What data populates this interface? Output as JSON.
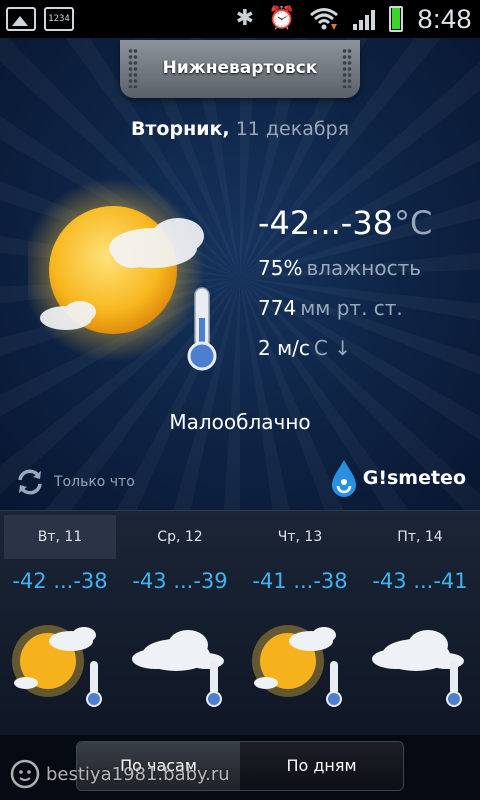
{
  "status_bar": {
    "time": "8:48",
    "icons": [
      "gallery-icon",
      "clock-widget-icon",
      "bluetooth-icon",
      "alarm-icon",
      "wifi-icon",
      "signal-icon",
      "battery-icon"
    ],
    "battery_level": 0.95
  },
  "city": "Нижневартовск",
  "date": {
    "weekday": "Вторник,",
    "day_month": "11 декабря"
  },
  "current": {
    "temp_range": "-42...-38",
    "temp_unit": "°C",
    "humidity_value": "75%",
    "humidity_label": "влажность",
    "pressure_value": "774",
    "pressure_unit": "мм рт. ст.",
    "wind_value": "2 м/с",
    "wind_dir_glyph": "С ↓",
    "condition": "Малооблачно",
    "icon": "sun-cloud-thermometer-icon"
  },
  "refresh": {
    "label": "Только что"
  },
  "brand": {
    "name": "G!smeteo"
  },
  "forecast": [
    {
      "label": "Вт, 11",
      "temp": "-42 ...-38",
      "icon": "sun-cloud-icon",
      "active": true
    },
    {
      "label": "Ср, 12",
      "temp": "-43 ...-39",
      "icon": "cloud-icon",
      "active": false
    },
    {
      "label": "Чт, 13",
      "temp": "-41 ...-38",
      "icon": "sun-cloud-icon",
      "active": false
    },
    {
      "label": "Пт, 14",
      "temp": "-43 ...-41",
      "icon": "cloud-icon",
      "active": false
    }
  ],
  "bottom_tabs": {
    "hours": "По часам",
    "days": "По дням",
    "selected": "hours"
  },
  "watermark": "bestiya1981.baby.ru",
  "colors": {
    "accent_temp": "#3fb3f2",
    "muted": "#9aa7b8",
    "battery": "#39d628"
  }
}
